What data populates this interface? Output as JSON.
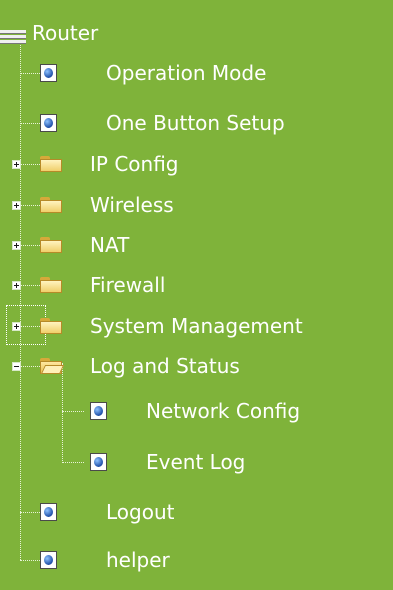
{
  "tree": {
    "root_label": "Router",
    "items": [
      {
        "label": "Operation Mode",
        "icon": "page-icon"
      },
      {
        "label": "One Button Setup",
        "icon": "page-icon"
      },
      {
        "label": "IP Config",
        "icon": "folder-icon",
        "expander": "+"
      },
      {
        "label": "Wireless",
        "icon": "folder-icon",
        "expander": "+"
      },
      {
        "label": "NAT",
        "icon": "folder-icon",
        "expander": "+"
      },
      {
        "label": "Firewall",
        "icon": "folder-icon",
        "expander": "+"
      },
      {
        "label": "System Management",
        "icon": "folder-icon",
        "expander": "+"
      },
      {
        "label": "Log and Status",
        "icon": "folder-open-icon",
        "expander": "-"
      },
      {
        "label": "Network Config",
        "icon": "page-icon"
      },
      {
        "label": "Event Log",
        "icon": "page-icon"
      },
      {
        "label": "Logout",
        "icon": "page-icon"
      },
      {
        "label": "helper",
        "icon": "page-icon"
      }
    ]
  },
  "colors": {
    "background": "#7fb33a",
    "text": "#ffffff"
  }
}
